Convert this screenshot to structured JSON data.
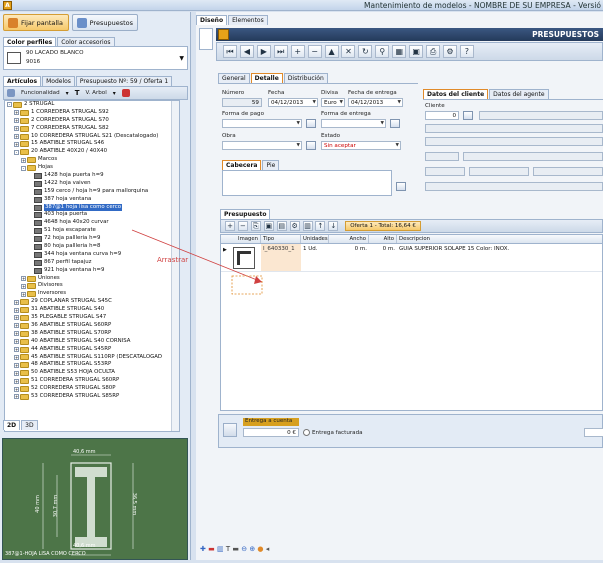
{
  "window": {
    "title": "Mantenimiento de modelos - NOMBRE DE SU EMPRESA - Versió"
  },
  "left": {
    "btn_fijar": "Fijar pantalla",
    "btn_presupuestos": "Presupuestos",
    "color_tabs": [
      "Color perfiles",
      "Color accesorios"
    ],
    "color_value_1": "90 LACADO BLANCO",
    "color_value_2": "9016",
    "tree_tabs": [
      "Artículos",
      "Modelos",
      "Presupuesto Nº: 59 / Oferta 1"
    ],
    "toolbar": {
      "funcionalidad": "Funcionalidad",
      "text_icon": "T",
      "vista": "V. Arbol"
    },
    "tree": [
      {
        "level": 0,
        "tog": "-",
        "icon": "fold",
        "text": "2 STRUGAL"
      },
      {
        "level": 1,
        "tog": "+",
        "icon": "fold",
        "text": "1 CORREDERA STRUGAL S92"
      },
      {
        "level": 1,
        "tog": "+",
        "icon": "fold",
        "text": "2 CORREDERA STRUGAL S70"
      },
      {
        "level": 1,
        "tog": "+",
        "icon": "fold",
        "text": "7 CORREDERA STRUGAL S82"
      },
      {
        "level": 1,
        "tog": "+",
        "icon": "fold",
        "text": "10 CORREDERA STRUGAL S21 (Descatalogado)"
      },
      {
        "level": 1,
        "tog": "+",
        "icon": "fold",
        "text": "15 ABATIBLE STRUGAL S46"
      },
      {
        "level": 1,
        "tog": "-",
        "icon": "fold",
        "text": "20 ABATIBLE 40X20 / 40X40"
      },
      {
        "level": 2,
        "tog": "+",
        "icon": "fold",
        "text": "Marcos"
      },
      {
        "level": 2,
        "tog": "-",
        "icon": "fold",
        "text": "Hojas"
      },
      {
        "level": 3,
        "tog": "",
        "icon": "pic",
        "text": "1428 hoja puerta h=9"
      },
      {
        "level": 3,
        "tog": "",
        "icon": "pic",
        "text": "1422 hoja vaiven"
      },
      {
        "level": 3,
        "tog": "",
        "icon": "pic",
        "text": "159 cerco / hoja h=9 para mallorquina"
      },
      {
        "level": 3,
        "tog": "",
        "icon": "pic",
        "text": "387 hoja ventana"
      },
      {
        "level": 3,
        "tog": "",
        "icon": "pic",
        "text": "387@1 hoja lisa como cerco",
        "hl": true
      },
      {
        "level": 3,
        "tog": "",
        "icon": "pic",
        "text": "403 hoja puerta"
      },
      {
        "level": 3,
        "tog": "",
        "icon": "pic",
        "text": "4648 hoja 40x20 curvar"
      },
      {
        "level": 3,
        "tog": "",
        "icon": "pic",
        "text": "51 hoja escaparate"
      },
      {
        "level": 3,
        "tog": "",
        "icon": "pic",
        "text": "72 hoja pallleria h=9"
      },
      {
        "level": 3,
        "tog": "",
        "icon": "pic",
        "text": "80 hoja pallleria h=8"
      },
      {
        "level": 3,
        "tog": "",
        "icon": "pic",
        "text": "344 hoja ventana curva h=9"
      },
      {
        "level": 3,
        "tog": "",
        "icon": "pic",
        "text": "867 perfil tapajuz"
      },
      {
        "level": 3,
        "tog": "",
        "icon": "pic",
        "text": "921 hoja ventana h=9"
      },
      {
        "level": 2,
        "tog": "+",
        "icon": "fold",
        "text": "Uniones"
      },
      {
        "level": 2,
        "tog": "+",
        "icon": "fold",
        "text": "Divisores"
      },
      {
        "level": 2,
        "tog": "+",
        "icon": "fold",
        "text": "Inversores"
      },
      {
        "level": 1,
        "tog": "+",
        "icon": "fold",
        "text": "29 COPLANAR STRUGAL S45C"
      },
      {
        "level": 1,
        "tog": "+",
        "icon": "fold",
        "text": "31 ABATIBLE STRUGAL S40"
      },
      {
        "level": 1,
        "tog": "+",
        "icon": "fold",
        "text": "35 PLEGABLE STRUGAL S47"
      },
      {
        "level": 1,
        "tog": "+",
        "icon": "fold",
        "text": "36 ABATIBLE STRUGAL S60RP"
      },
      {
        "level": 1,
        "tog": "+",
        "icon": "fold",
        "text": "38 ABATIBLE STRUGAL S70RP"
      },
      {
        "level": 1,
        "tog": "+",
        "icon": "fold",
        "text": "40 ABATIBLE STRUGAL S40 CORNISA"
      },
      {
        "level": 1,
        "tog": "+",
        "icon": "fold",
        "text": "44 ABATIBLE STRUGAL S45RP"
      },
      {
        "level": 1,
        "tog": "+",
        "icon": "fold",
        "text": "45 ABATIBLE STRUGAL S110RP (DESCATALOGAD"
      },
      {
        "level": 1,
        "tog": "+",
        "icon": "fold",
        "text": "48 ABATIBLE STRUGAL S53RP"
      },
      {
        "level": 1,
        "tog": "+",
        "icon": "fold",
        "text": "50 ABATIBLE S53 HOJA OCULTA"
      },
      {
        "level": 1,
        "tog": "+",
        "icon": "fold",
        "text": "51 CORREDERA STRUGAL S60RP"
      },
      {
        "level": 1,
        "tog": "+",
        "icon": "fold",
        "text": "52 CORREDERA STRUGAL S80P"
      },
      {
        "level": 1,
        "tog": "+",
        "icon": "fold",
        "text": "53 CORREDERA STRUGAL S85RP"
      }
    ],
    "view_tabs": [
      "2D",
      "3D"
    ],
    "drawing": {
      "dim_top": "40,6 mm",
      "dim_left_outer": "40 mm",
      "dim_left_inner": "30,7 mm",
      "dim_right": "36,5 mm",
      "dim_bottom": "40,6 mm",
      "caption": "387@1-HOJA LISA COMO CERCO"
    }
  },
  "right": {
    "tabs": [
      "Diseño",
      "Elementos"
    ],
    "header_title": "PRESUPUESTOS",
    "form_tabs": [
      "General",
      "Detalle",
      "Distribución"
    ],
    "labels": {
      "numero": "Número",
      "fecha": "Fecha",
      "divisa": "Divisa",
      "fecha_entrega": "Fecha de entrega",
      "forma_pago": "Forma de pago",
      "forma_entrega": "Forma de entrega",
      "obra": "Obra",
      "estado": "Estado"
    },
    "values": {
      "numero": "59",
      "fecha": "04/12/2013",
      "divisa": "Euro",
      "fecha_entrega": "04/12/2013",
      "estado": "Sin aceptar"
    },
    "client_tabs": [
      "Datos del cliente",
      "Datos del agente"
    ],
    "cliente_label": "Cliente",
    "cliente_value": "0",
    "footer_tabs": [
      "Cabecera",
      "Pie"
    ],
    "presupuesto_tab": "Presupuesto",
    "oferta_tab": "Oferta 1 - Total: 16,64 €",
    "grid": {
      "headers": [
        "Imagen",
        "Tipo",
        "Unidades",
        "Ancho",
        "Alto",
        "Descripcion"
      ],
      "row": {
        "tipo": "I_640330_1",
        "unidades": "1 Ud.",
        "ancho": "0 m.",
        "alto": "0 m.",
        "descripcion": "GUIA SUPERIOR SOLAPE 15  Color: INOX."
      }
    },
    "arrastrar": "Arrastrar",
    "entrega_cuenta_label": "Entrega a cuenta",
    "entrega_cuenta_value": "0 €",
    "entrega_facturada": "Entrega facturada"
  },
  "colors": {
    "accent": "#316ac5",
    "drawing_bg": "#4d7548",
    "folder": "#e9bf49",
    "header_dark": "#243a5a"
  }
}
